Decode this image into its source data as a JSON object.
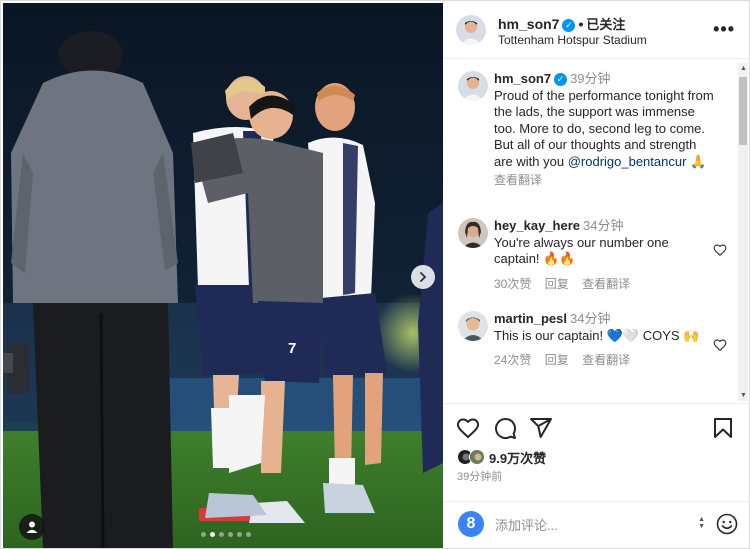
{
  "post": {
    "username": "hm_son7",
    "follow_state": "已关注",
    "separator": "•",
    "location": "Tottenham Hotspur Stadium",
    "caption_time": "39分钟",
    "caption": "Proud of the performance tonight from the lads, the support was immense too. More to do, second leg to come. But all of our thoughts and strength are with you ",
    "caption_mention": "@rodrigo_bentancur",
    "caption_emoji": "🙏",
    "see_translation": "查看翻译",
    "likes": "9.9万次赞",
    "posted_ago": "39分钟前",
    "comment_placeholder": "添加评论...",
    "emoji_button": "8"
  },
  "comments": [
    {
      "username": "hey_kay_here",
      "time": "34分钟",
      "text": "You're always our number one captain! 🔥🔥",
      "likes": "30次赞",
      "reply": "回复",
      "translate": "查看翻译"
    },
    {
      "username": "martin_pesl",
      "time": "34分钟",
      "text": "This is our captain! 💙🤍 COYS 🙌",
      "likes": "24次赞",
      "reply": "回复",
      "translate": "查看翻译"
    }
  ],
  "icons": {
    "verified": "verified-badge-icon",
    "more": "more-options-icon",
    "like": "heart-icon",
    "comment": "comment-icon",
    "share": "share-icon",
    "save": "bookmark-icon",
    "next": "chevron-right-icon",
    "tag": "user-tag-icon",
    "emoji": "smile-icon"
  },
  "colors": {
    "verified_blue": "#0095f6",
    "mention": "#00376b",
    "muted": "#8e8e8e",
    "text": "#262626"
  },
  "carousel": {
    "slides": 6,
    "active": 1
  }
}
